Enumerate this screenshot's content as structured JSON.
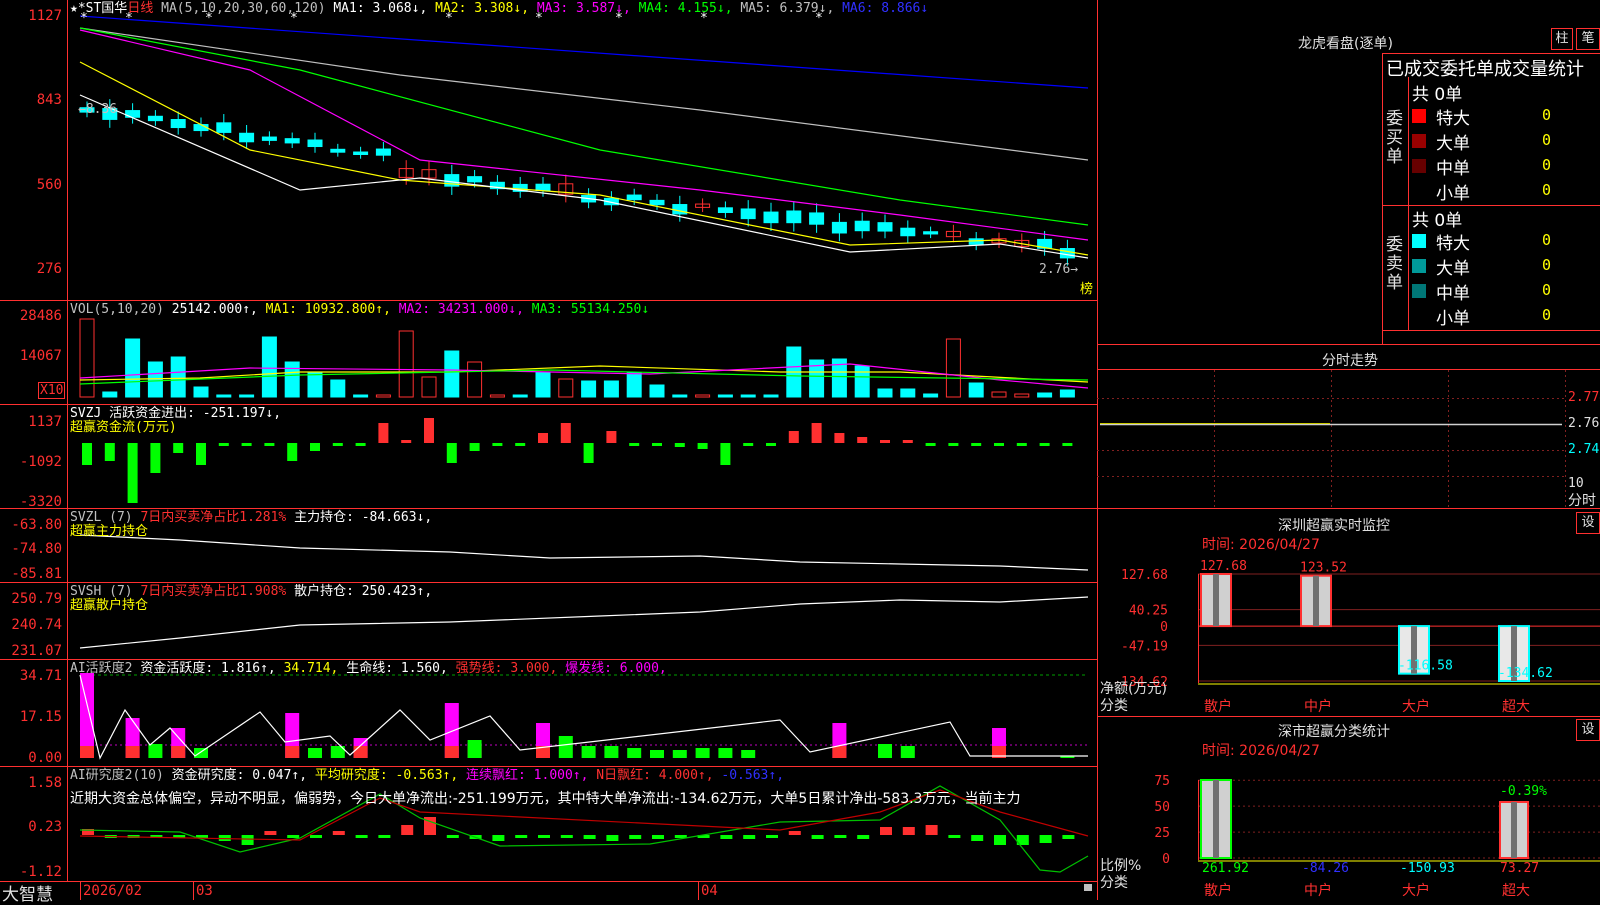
{
  "colors": {
    "up": "#ff3030",
    "down": "#00ffff",
    "border": "#ff3030",
    "ma1": "#ffffff",
    "ma2": "#ffff00",
    "ma3": "#ff00ff",
    "ma4": "#00ff00",
    "ma5": "#c0c0c0",
    "ma6": "#0000ff",
    "green": "#00ff00"
  },
  "main_chart": {
    "star": "★",
    "stock_name": "*ST国华",
    "period": "日线",
    "ma_label": "MA(5,10,20,30,60,120)",
    "ma1": "MA1: 3.068↓,",
    "ma2": "MA2: 3.308↓,",
    "ma3": "MA3: 3.587↓,",
    "ma4": "MA4: 4.155↓,",
    "ma5": "MA5: 6.379↓,",
    "ma6": "MA6: 8.866↓",
    "y_ticks": [
      "1127",
      "843",
      "560",
      "276"
    ],
    "high_label": "←8.36",
    "low_label": "2.76→",
    "rank_label": "榜"
  },
  "vol_panel": {
    "label": "VOL(5,10,20)",
    "value": "25142.000↑,",
    "ma1": "MA1: 10932.800↑,",
    "ma2": "MA2: 34231.000↓,",
    "ma3": "MA3: 55134.250↓",
    "y_ticks": [
      "28486",
      "14067"
    ],
    "unit": "X10"
  },
  "svzj_panel": {
    "label": "SVZJ  活跃资金进出: -251.197↓,",
    "subtitle": "超赢资金流(万元)",
    "y_ticks": [
      "1137",
      "-1092",
      "-3320"
    ]
  },
  "svzl_panel": {
    "label": "SVZL (7)",
    "ratio": "7日内买卖净占比1.281%",
    "hold": "主力持仓: -84.663↓,",
    "subtitle": "超赢主力持仓",
    "y_ticks": [
      "-63.80",
      "-74.80",
      "-85.81"
    ]
  },
  "svsh_panel": {
    "label": "SVSH (7)",
    "ratio": "7日内买卖净占比1.908%",
    "hold": "散户持仓: 250.423↑,",
    "subtitle": "超赢散户持仓",
    "y_ticks": [
      "250.79",
      "240.74",
      "231.07"
    ]
  },
  "ai_active_panel": {
    "label": "AI活跃度2",
    "v1": "资金活跃度: 1.816↑,",
    "v2": "34.714,",
    "v3": "生命线: 1.560,",
    "v4": "强势线: 3.000,",
    "v5": "爆发线: 6.000,",
    "y_ticks": [
      "34.71",
      "17.15",
      "0.00"
    ]
  },
  "ai_research_panel": {
    "label": "AI研究度2(10)",
    "v1": "资金研究度: 0.047↑,",
    "v2": "平均研究度: -0.563↑,",
    "v3": "连续飘红: 1.000↑,",
    "v4": "N日飘红: 4.000↑,",
    "v5": "-0.563↑,",
    "comment": "近期大资金总体偏空，异动不明显，偏弱势，今日大单净流出:-251.199万元，其中特大单净流出:-134.62万元，大单5日累计净出-583.3万元，当前主力",
    "y_ticks": [
      "1.58",
      "0.23",
      "-1.12"
    ]
  },
  "bottom_bar": {
    "brand": "大智慧",
    "dates": [
      "2026/02",
      "03",
      "04"
    ]
  },
  "right_panel": {
    "top_title": "龙虎看盘(逐单)",
    "btn1": "柱",
    "btn2": "笔",
    "stats_title": "已成交委托单成交量统计",
    "buy_group": "委买单",
    "sell_group": "委卖单",
    "buy_total": "共 0单",
    "sell_total": "共 0单",
    "buy_rows": [
      {
        "label": "特大",
        "value": "0",
        "color": "#ff0000"
      },
      {
        "label": "大单",
        "value": "0",
        "color": "#990000"
      },
      {
        "label": "中单",
        "value": "0",
        "color": "#660000"
      },
      {
        "label": "小单",
        "value": "0",
        "color": "#000000"
      }
    ],
    "sell_rows": [
      {
        "label": "特大",
        "value": "0",
        "color": "#00ffff"
      },
      {
        "label": "大单",
        "value": "0",
        "color": "#009999"
      },
      {
        "label": "中单",
        "value": "0",
        "color": "#007777"
      },
      {
        "label": "小单",
        "value": "0",
        "color": "#000000"
      }
    ],
    "intraday_title": "分时走势",
    "intraday_ticks": [
      "2.774",
      "2.760",
      "2.746"
    ],
    "intraday_unit1": "10",
    "intraday_unit2": "分时",
    "monitor_title": "深圳超赢实时监控",
    "monitor_set": "设",
    "monitor_time": "时间: 2026/04/27",
    "monitor_yticks": [
      "127.68",
      "40.25",
      "0",
      "-47.19",
      "-134.62"
    ],
    "monitor_bars": [
      {
        "cat": "散户",
        "value": 127.68,
        "label": "127.68"
      },
      {
        "cat": "中户",
        "value": 123.52,
        "label": "123.52"
      },
      {
        "cat": "大户",
        "value": -116.58,
        "label": "-116.58"
      },
      {
        "cat": "超大",
        "value": -134.62,
        "label": "-134.62"
      }
    ],
    "monitor_ylabel1": "净额(万元)",
    "monitor_ylabel2": "分类",
    "class_title": "深市超赢分类统计",
    "class_set": "设",
    "class_time": "时间: 2026/04/27",
    "class_yticks": [
      "75",
      "50",
      "25",
      "0"
    ],
    "class_bars": [
      {
        "cat": "散户",
        "value": 261.92,
        "label": "261.92"
      },
      {
        "cat": "中户",
        "value": -84.26,
        "label": "-84.26"
      },
      {
        "cat": "大户",
        "value": -150.93,
        "label": "-150.93"
      },
      {
        "cat": "超大",
        "value": 73.27,
        "label": "73.27"
      }
    ],
    "class_pct": "-0.39%",
    "class_ylabel1": "比例%",
    "class_ylabel2": "分类"
  },
  "chart_data": [
    {
      "type": "candlestick",
      "title": "*ST国华 日线",
      "ylim": [
        2.76,
        11.27
      ],
      "series": [
        {
          "name": "MA1",
          "value": 3.068
        },
        {
          "name": "MA2",
          "value": 3.308
        },
        {
          "name": "MA3",
          "value": 3.587
        },
        {
          "name": "MA4",
          "value": 4.155
        },
        {
          "name": "MA5",
          "value": 6.379
        },
        {
          "name": "MA6",
          "value": 8.866
        }
      ],
      "annotations": [
        "←8.36",
        "2.76→"
      ]
    },
    {
      "type": "bar",
      "title": "深圳超赢实时监控",
      "categories": [
        "散户",
        "中户",
        "大户",
        "超大"
      ],
      "values": [
        127.68,
        123.52,
        -116.58,
        -134.62
      ],
      "ylabel": "净额(万元)",
      "ylim": [
        -134.62,
        127.68
      ]
    },
    {
      "type": "bar",
      "title": "深市超赢分类统计",
      "categories": [
        "散户",
        "中户",
        "大户",
        "超大"
      ],
      "values": [
        261.92,
        -84.26,
        -150.93,
        73.27
      ],
      "ylabel": "比例%",
      "ylim": [
        0,
        75
      ]
    }
  ]
}
